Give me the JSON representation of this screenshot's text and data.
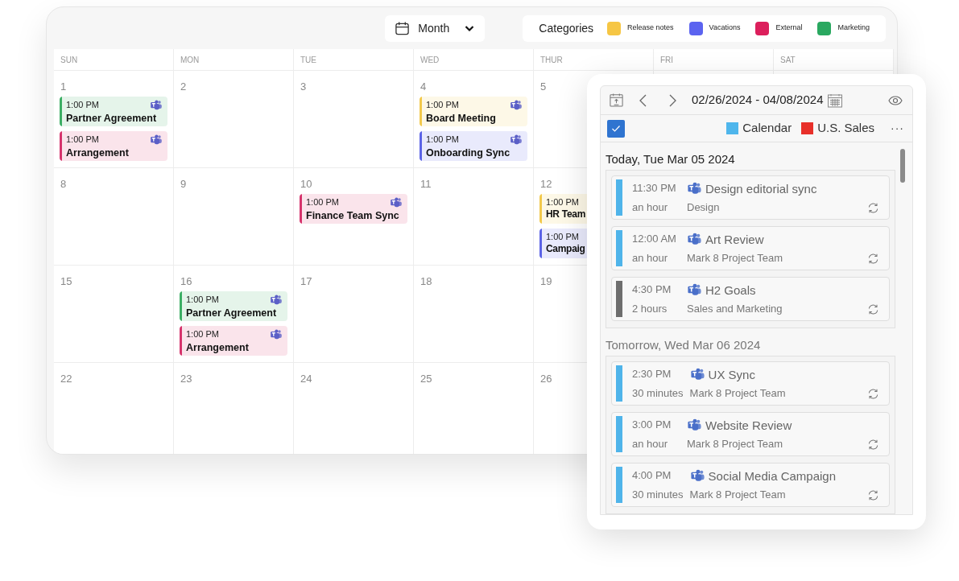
{
  "toolbar": {
    "view": "Month",
    "categories_label": "Categories",
    "categories": [
      {
        "label": "Release notes",
        "color": "#f6c644"
      },
      {
        "label": "Vacations",
        "color": "#5b63f0"
      },
      {
        "label": "External",
        "color": "#dc1f5c"
      },
      {
        "label": "Marketing",
        "color": "#2aa860"
      }
    ]
  },
  "weekdays": [
    "SUN",
    "MON",
    "TUE",
    "WED",
    "THUR",
    "FRI",
    "SAT"
  ],
  "weeks": [
    [
      {
        "day": "1",
        "events": [
          {
            "time": "1:00 PM",
            "title": "Partner Agreement",
            "color": "#3cae64"
          },
          {
            "time": "1:00 PM",
            "title": "Arrangement",
            "color": "#d6336c"
          }
        ]
      },
      {
        "day": "2"
      },
      {
        "day": "3"
      },
      {
        "day": "4",
        "events": [
          {
            "time": "1:00 PM",
            "title": "Board Meeting",
            "color": "#f2c94c"
          },
          {
            "time": "1:00 PM",
            "title": "Onboarding Sync",
            "color": "#5b63e6"
          }
        ]
      },
      {
        "day": "5"
      }
    ],
    [
      {
        "day": "8"
      },
      {
        "day": "9"
      },
      {
        "day": "10",
        "events": [
          {
            "time": "1:00 PM",
            "title": "Finance Team Sync",
            "color": "#d6336c"
          }
        ]
      },
      {
        "day": "11"
      },
      {
        "day": "12",
        "events": [
          {
            "time": "1:00 PM",
            "title": "HR Team",
            "color": "#f2c94c"
          },
          {
            "time": "1:00 PM",
            "title": "Campaig",
            "color": "#5b63e6"
          }
        ]
      }
    ],
    [
      {
        "day": "15"
      },
      {
        "day": "16",
        "events": [
          {
            "time": "1:00 PM",
            "title": "Partner Agreement",
            "color": "#3cae64"
          },
          {
            "time": "1:00 PM",
            "title": "Arrangement",
            "color": "#d6336c"
          }
        ]
      },
      {
        "day": "17"
      },
      {
        "day": "18"
      },
      {
        "day": "19"
      }
    ],
    [
      {
        "day": "22"
      },
      {
        "day": "23"
      },
      {
        "day": "24"
      },
      {
        "day": "25"
      },
      {
        "day": "26"
      }
    ]
  ],
  "agenda": {
    "date_range": "02/26/2024 - 04/08/2024",
    "select_all": {
      "checked": true
    },
    "calendars": [
      {
        "label": "Calendar",
        "color": "#4fb6ec"
      },
      {
        "label": "U.S. Sales",
        "color": "#e8302a"
      }
    ],
    "more": "···",
    "sections": [
      {
        "heading": "Today, Tue Mar 05 2024",
        "items": [
          {
            "time": "11:30 PM",
            "duration": "an hour",
            "title": "Design editorial sync",
            "group": "Design",
            "color": "#4fb4ea"
          },
          {
            "time": "12:00 AM",
            "duration": "an hour",
            "title": "Art Review",
            "group": "Mark 8 Project Team",
            "color": "#4fb4ea"
          },
          {
            "time": "4:30 PM",
            "duration": "2 hours",
            "title": "H2 Goals",
            "group": "Sales and Marketing",
            "color": "#6e6e6e"
          }
        ]
      },
      {
        "heading": "Tomorrow, Wed Mar 06 2024",
        "items": [
          {
            "time": "2:30 PM",
            "duration": "30 minutes",
            "title": "UX Sync",
            "group": "Mark 8 Project Team",
            "color": "#4fb4ea"
          },
          {
            "time": "3:00 PM",
            "duration": "an hour",
            "title": "Website Review",
            "group": "Mark 8 Project Team",
            "color": "#4fb4ea"
          },
          {
            "time": "4:00 PM",
            "duration": "30 minutes",
            "title": "Social Media Campaign",
            "group": "Mark 8 Project Team",
            "color": "#4fb4ea"
          }
        ]
      }
    ]
  }
}
